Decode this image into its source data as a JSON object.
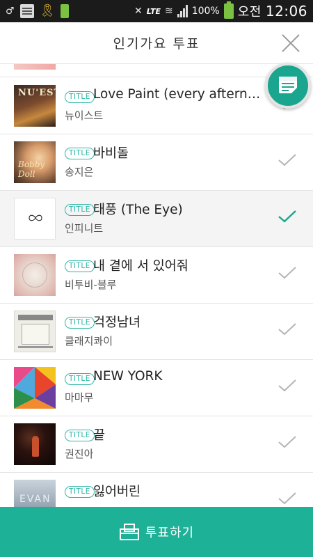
{
  "status_bar": {
    "percent": "100%",
    "ampm": "오전",
    "time": "12:06",
    "lte": "LTE",
    "battery_small_label": "100%"
  },
  "header": {
    "title": "인기가요 투표"
  },
  "songs": [
    {
      "badge": "TITLE",
      "title": "Love Paint (every afterno...",
      "artist": "뉴이스트",
      "selected": false
    },
    {
      "badge": "TITLE",
      "title": "바비돌",
      "artist": "송지은",
      "selected": false
    },
    {
      "badge": "TITLE",
      "title": "태풍 (The Eye)",
      "artist": "인피니트",
      "selected": true
    },
    {
      "badge": "TITLE",
      "title": "내 곁에 서 있어줘",
      "artist": "비투비-블루",
      "selected": false
    },
    {
      "badge": "TITLE",
      "title": "걱정남녀",
      "artist": "클래지콰이",
      "selected": false
    },
    {
      "badge": "TITLE",
      "title": "NEW YORK",
      "artist": "마마무",
      "selected": false
    },
    {
      "badge": "TITLE",
      "title": "끝",
      "artist": "권진아",
      "selected": false
    },
    {
      "badge": "TITLE",
      "title": "잃어버린",
      "artist": "",
      "selected": false
    }
  ],
  "thumb_text": {
    "nuest": "NU'EST",
    "songji": "Bobby Doll",
    "ilheo": "EVAN"
  },
  "vote_button": {
    "label": "투표하기"
  },
  "colors": {
    "accent": "#1db197",
    "check_selected": "#1aa58f",
    "check_idle": "#b5b5b5"
  }
}
